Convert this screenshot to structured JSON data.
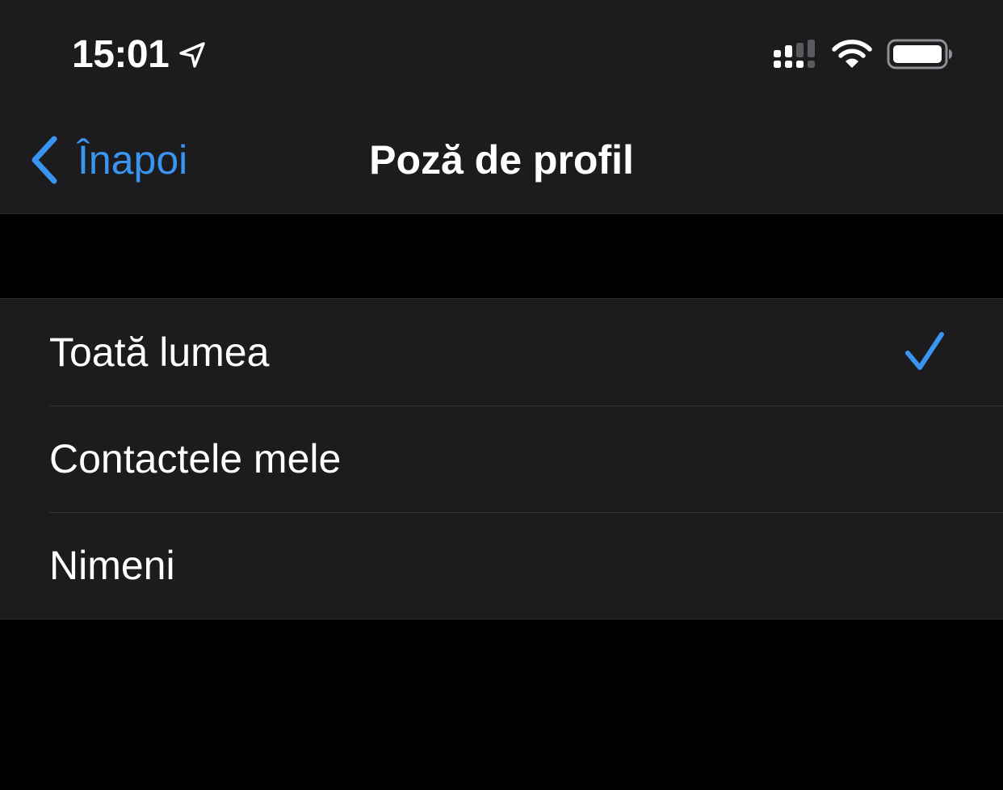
{
  "status_bar": {
    "time": "15:01",
    "icons": [
      "location-arrow-icon",
      "cellular-signal-icon",
      "wifi-icon",
      "battery-icon"
    ]
  },
  "nav": {
    "back_label": "Înapoi",
    "title": "Poză de profil"
  },
  "options": [
    {
      "label": "Toată lumea",
      "selected": true
    },
    {
      "label": "Contactele mele",
      "selected": false
    },
    {
      "label": "Nimeni",
      "selected": false
    }
  ],
  "colors": {
    "accent": "#3a94f2",
    "bar_background": "#1c1c1e",
    "page_background": "#000000",
    "separator": "#38383a"
  }
}
